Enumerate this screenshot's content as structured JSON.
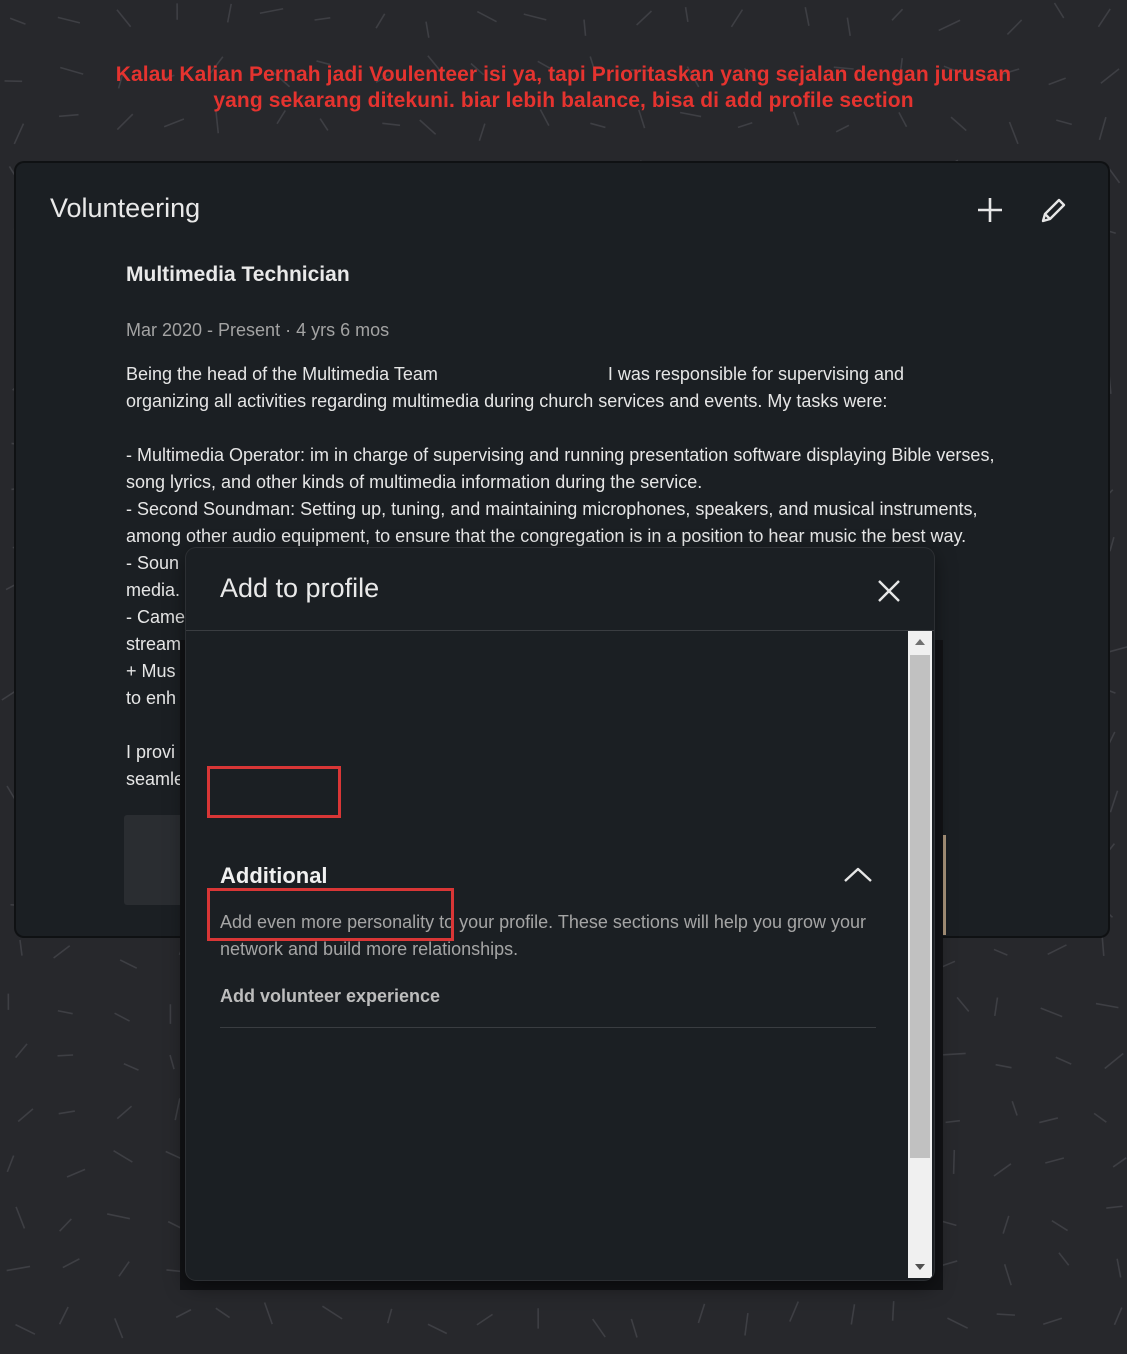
{
  "annotation": {
    "line1": "Kalau  Kalian Pernah jadi Voulenteer isi ya, tapi Prioritaskan yang sejalan dengan jurusan",
    "line2": "yang sekarang ditekuni. biar lebih balance, bisa di add profile section"
  },
  "volunteering": {
    "title": "Volunteering",
    "add_icon": "plus-icon",
    "edit_icon": "pencil-icon",
    "entry": {
      "title": "Multimedia Technician",
      "dates": "Mar 2020 - Present · 4 yrs 6 mos",
      "description_lines": [
        "Being the head of the Multimedia Team                                  I was responsible for supervising and",
        "organizing all activities regarding multimedia during church services and events. My tasks were:",
        "",
        "- Multimedia Operator: im in charge of supervising and running presentation software displaying Bible verses,",
        "song lyrics, and other kinds of multimedia information during the service.",
        "- Second Soundman: Setting up, tuning, and maintaining microphones, speakers, and musical instruments,",
        "among other audio equipment, to ensure that the congregation is in a position to hear music the best way.",
        "- Soun                                                                                                                       rch events and",
        "media.",
        "- Came                                                                                                                       ents for live",
        "stream",
        "+ Mus                                                                                                                        worship team",
        "to enh",
        "",
        "I provi                                                                                                                      sts had a",
        "seamle"
      ]
    }
  },
  "modal": {
    "title": "Add to profile",
    "close_icon": "close-icon",
    "section": {
      "heading": "Additional",
      "toggle_icon": "chevron-up-icon",
      "description": "Add even more personality to your profile. These sections will help you grow your network and build more relationships.",
      "action": "Add volunteer experience"
    }
  },
  "colors": {
    "annotation": "#e5332f",
    "highlight": "#d93636",
    "card_bg": "#1b1f23",
    "page_bg": "#27282c"
  }
}
